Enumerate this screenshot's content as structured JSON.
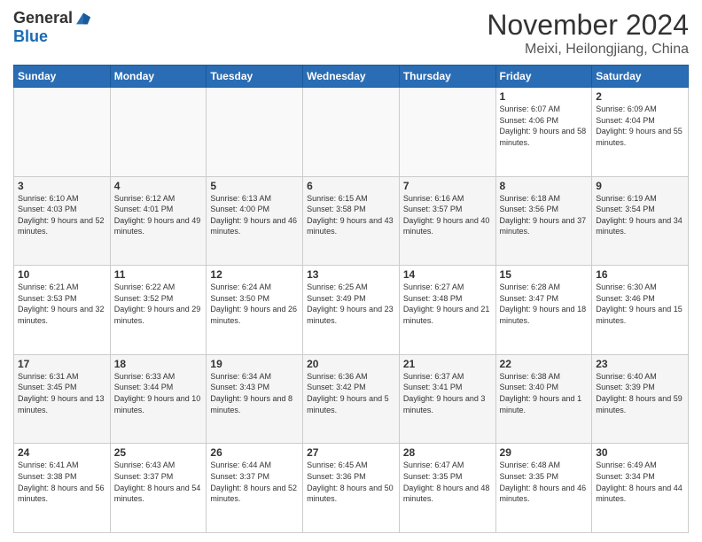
{
  "header": {
    "logo_general": "General",
    "logo_blue": "Blue",
    "month_title": "November 2024",
    "location": "Meixi, Heilongjiang, China"
  },
  "weekdays": [
    "Sunday",
    "Monday",
    "Tuesday",
    "Wednesday",
    "Thursday",
    "Friday",
    "Saturday"
  ],
  "weeks": [
    [
      {
        "day": "",
        "info": ""
      },
      {
        "day": "",
        "info": ""
      },
      {
        "day": "",
        "info": ""
      },
      {
        "day": "",
        "info": ""
      },
      {
        "day": "",
        "info": ""
      },
      {
        "day": "1",
        "info": "Sunrise: 6:07 AM\nSunset: 4:06 PM\nDaylight: 9 hours and 58 minutes."
      },
      {
        "day": "2",
        "info": "Sunrise: 6:09 AM\nSunset: 4:04 PM\nDaylight: 9 hours and 55 minutes."
      }
    ],
    [
      {
        "day": "3",
        "info": "Sunrise: 6:10 AM\nSunset: 4:03 PM\nDaylight: 9 hours and 52 minutes."
      },
      {
        "day": "4",
        "info": "Sunrise: 6:12 AM\nSunset: 4:01 PM\nDaylight: 9 hours and 49 minutes."
      },
      {
        "day": "5",
        "info": "Sunrise: 6:13 AM\nSunset: 4:00 PM\nDaylight: 9 hours and 46 minutes."
      },
      {
        "day": "6",
        "info": "Sunrise: 6:15 AM\nSunset: 3:58 PM\nDaylight: 9 hours and 43 minutes."
      },
      {
        "day": "7",
        "info": "Sunrise: 6:16 AM\nSunset: 3:57 PM\nDaylight: 9 hours and 40 minutes."
      },
      {
        "day": "8",
        "info": "Sunrise: 6:18 AM\nSunset: 3:56 PM\nDaylight: 9 hours and 37 minutes."
      },
      {
        "day": "9",
        "info": "Sunrise: 6:19 AM\nSunset: 3:54 PM\nDaylight: 9 hours and 34 minutes."
      }
    ],
    [
      {
        "day": "10",
        "info": "Sunrise: 6:21 AM\nSunset: 3:53 PM\nDaylight: 9 hours and 32 minutes."
      },
      {
        "day": "11",
        "info": "Sunrise: 6:22 AM\nSunset: 3:52 PM\nDaylight: 9 hours and 29 minutes."
      },
      {
        "day": "12",
        "info": "Sunrise: 6:24 AM\nSunset: 3:50 PM\nDaylight: 9 hours and 26 minutes."
      },
      {
        "day": "13",
        "info": "Sunrise: 6:25 AM\nSunset: 3:49 PM\nDaylight: 9 hours and 23 minutes."
      },
      {
        "day": "14",
        "info": "Sunrise: 6:27 AM\nSunset: 3:48 PM\nDaylight: 9 hours and 21 minutes."
      },
      {
        "day": "15",
        "info": "Sunrise: 6:28 AM\nSunset: 3:47 PM\nDaylight: 9 hours and 18 minutes."
      },
      {
        "day": "16",
        "info": "Sunrise: 6:30 AM\nSunset: 3:46 PM\nDaylight: 9 hours and 15 minutes."
      }
    ],
    [
      {
        "day": "17",
        "info": "Sunrise: 6:31 AM\nSunset: 3:45 PM\nDaylight: 9 hours and 13 minutes."
      },
      {
        "day": "18",
        "info": "Sunrise: 6:33 AM\nSunset: 3:44 PM\nDaylight: 9 hours and 10 minutes."
      },
      {
        "day": "19",
        "info": "Sunrise: 6:34 AM\nSunset: 3:43 PM\nDaylight: 9 hours and 8 minutes."
      },
      {
        "day": "20",
        "info": "Sunrise: 6:36 AM\nSunset: 3:42 PM\nDaylight: 9 hours and 5 minutes."
      },
      {
        "day": "21",
        "info": "Sunrise: 6:37 AM\nSunset: 3:41 PM\nDaylight: 9 hours and 3 minutes."
      },
      {
        "day": "22",
        "info": "Sunrise: 6:38 AM\nSunset: 3:40 PM\nDaylight: 9 hours and 1 minute."
      },
      {
        "day": "23",
        "info": "Sunrise: 6:40 AM\nSunset: 3:39 PM\nDaylight: 8 hours and 59 minutes."
      }
    ],
    [
      {
        "day": "24",
        "info": "Sunrise: 6:41 AM\nSunset: 3:38 PM\nDaylight: 8 hours and 56 minutes."
      },
      {
        "day": "25",
        "info": "Sunrise: 6:43 AM\nSunset: 3:37 PM\nDaylight: 8 hours and 54 minutes."
      },
      {
        "day": "26",
        "info": "Sunrise: 6:44 AM\nSunset: 3:37 PM\nDaylight: 8 hours and 52 minutes."
      },
      {
        "day": "27",
        "info": "Sunrise: 6:45 AM\nSunset: 3:36 PM\nDaylight: 8 hours and 50 minutes."
      },
      {
        "day": "28",
        "info": "Sunrise: 6:47 AM\nSunset: 3:35 PM\nDaylight: 8 hours and 48 minutes."
      },
      {
        "day": "29",
        "info": "Sunrise: 6:48 AM\nSunset: 3:35 PM\nDaylight: 8 hours and 46 minutes."
      },
      {
        "day": "30",
        "info": "Sunrise: 6:49 AM\nSunset: 3:34 PM\nDaylight: 8 hours and 44 minutes."
      }
    ]
  ]
}
